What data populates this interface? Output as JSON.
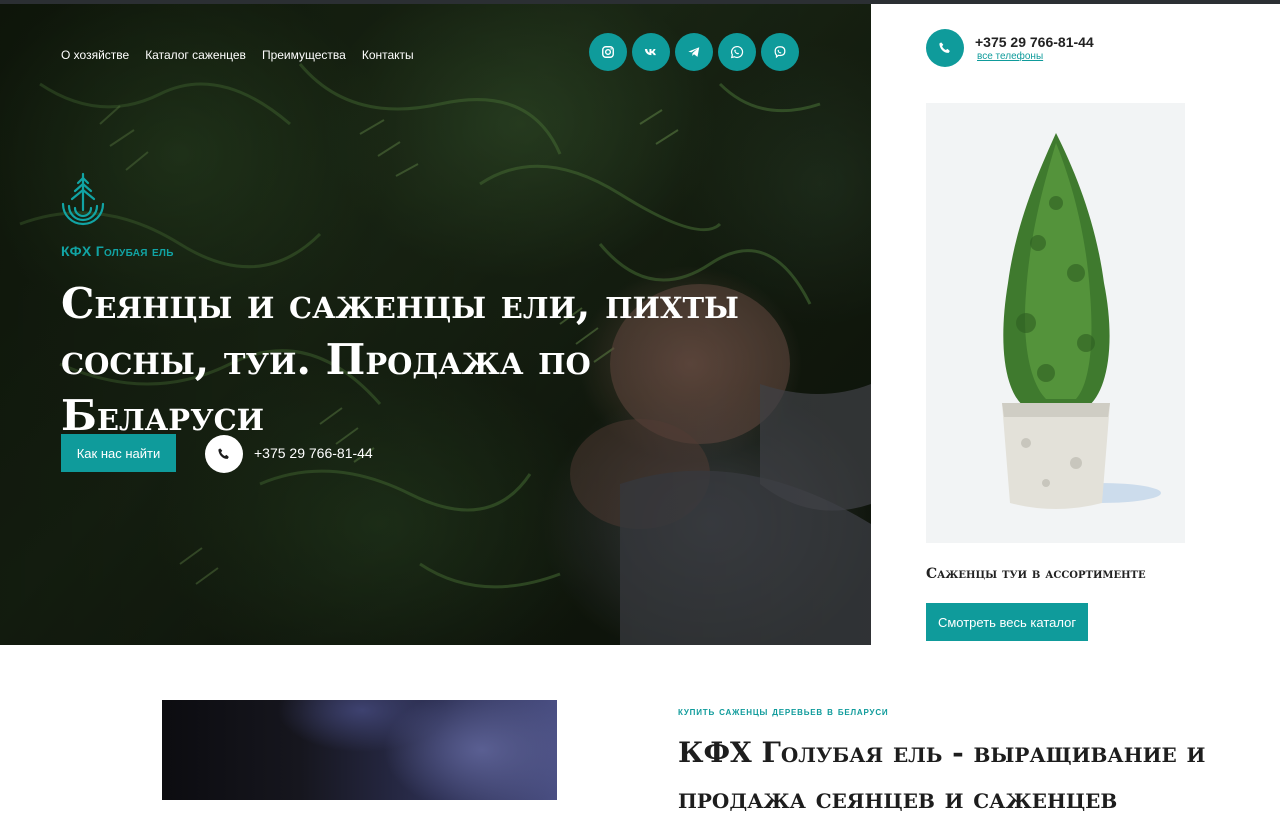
{
  "nav": {
    "items": [
      "О хозяйстве",
      "Каталог саженцев",
      "Преимущества",
      "Контакты"
    ]
  },
  "socials": [
    "instagram-icon",
    "vk-icon",
    "telegram-icon",
    "whatsapp-icon",
    "viber-icon"
  ],
  "brand": {
    "name": "КФХ Голубая ель",
    "accent_color": "#0f9b9b"
  },
  "hero": {
    "title": "Сеянцы и саженцы ели, пихты сосны, туи. Продажа по Беларуси",
    "find_button": "Как нас найти",
    "phone": "+375 29 766-81-44"
  },
  "contact": {
    "phone": "+375 29 766-81-44",
    "all_phones_link": "все телефоны"
  },
  "product": {
    "caption": "Саженцы туи в ассортименте",
    "catalog_button": "Смотреть весь каталог"
  },
  "about": {
    "eyebrow": "купить саженцы деревьев в беларуси",
    "title": "КФХ Голубая ель - выращивание и продажа сеянцев и саженцев"
  }
}
